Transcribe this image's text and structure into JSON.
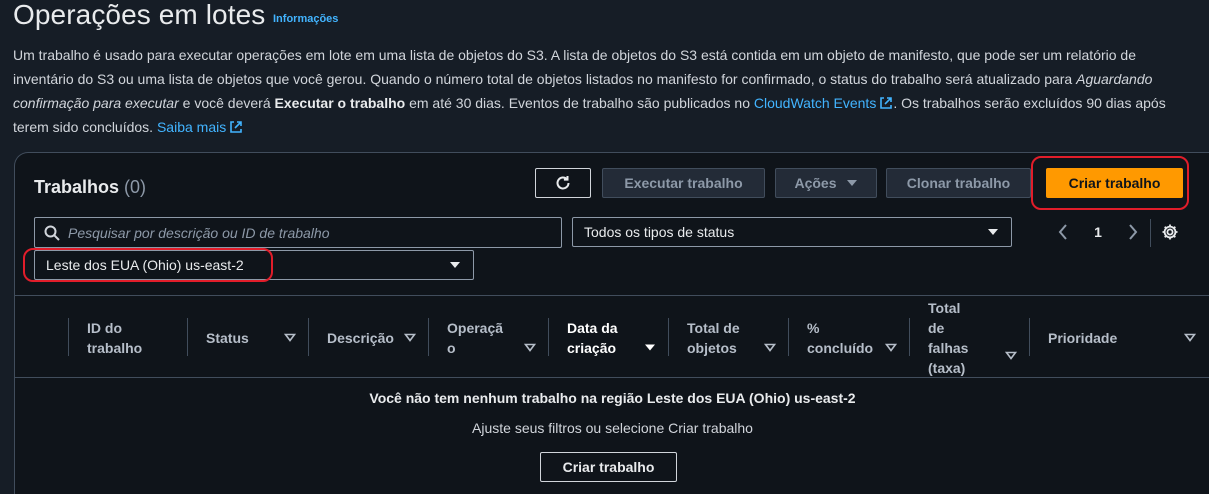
{
  "header": {
    "title": "Operações em lotes",
    "info_link": "Informações"
  },
  "description": {
    "p1": "Um trabalho é usado para executar operações em lote em uma lista de objetos do S3. A lista de objetos do S3 está contida em um objeto de manifesto, que pode ser um relatório de inventário do S3 ou uma lista de objetos que você gerou. Quando o número total de objetos listados no manifesto for confirmado, o status do trabalho será atualizado para ",
    "italic": "Aguardando confirmação para executar",
    "p2": " e você deverá ",
    "bold": "Executar o trabalho",
    "p3": " em até 30 dias. Eventos de trabalho são publicados no ",
    "link1": "CloudWatch Events",
    "p4": ". Os trabalhos serão excluídos 90 dias após terem sido concluídos. ",
    "link2": "Saiba mais"
  },
  "panel": {
    "title": "Trabalhos",
    "count": "(0)",
    "buttons": {
      "execute": "Executar trabalho",
      "actions": "Ações",
      "clone": "Clonar trabalho",
      "create": "Criar trabalho"
    },
    "search": {
      "placeholder": "Pesquisar por descrição ou ID de trabalho",
      "value": ""
    },
    "status_filter": "Todos os tipos de status",
    "region_filter": "Leste dos EUA (Ohio) us-east-2",
    "pagination": {
      "current_page": "1"
    }
  },
  "table": {
    "columns": [
      {
        "label": "ID do trabalho"
      },
      {
        "label": "Status"
      },
      {
        "label": "Descrição"
      },
      {
        "label": "Operação"
      },
      {
        "label": "Data da criação"
      },
      {
        "label": "Total de objetos"
      },
      {
        "label": "% concluído"
      },
      {
        "label": "Total de falhas (taxa)"
      },
      {
        "label": "Prioridade"
      }
    ]
  },
  "empty_state": {
    "title": "Você não tem nenhum trabalho na região Leste dos EUA (Ohio) us-east-2",
    "subtitle": "Ajuste seus filtros ou selecione Criar trabalho",
    "button": "Criar trabalho"
  },
  "colors": {
    "background": "#161d26",
    "panel": "#0f141a",
    "primary": "#ff9900",
    "link": "#42b4ff",
    "annotation": "#e11d2a"
  }
}
